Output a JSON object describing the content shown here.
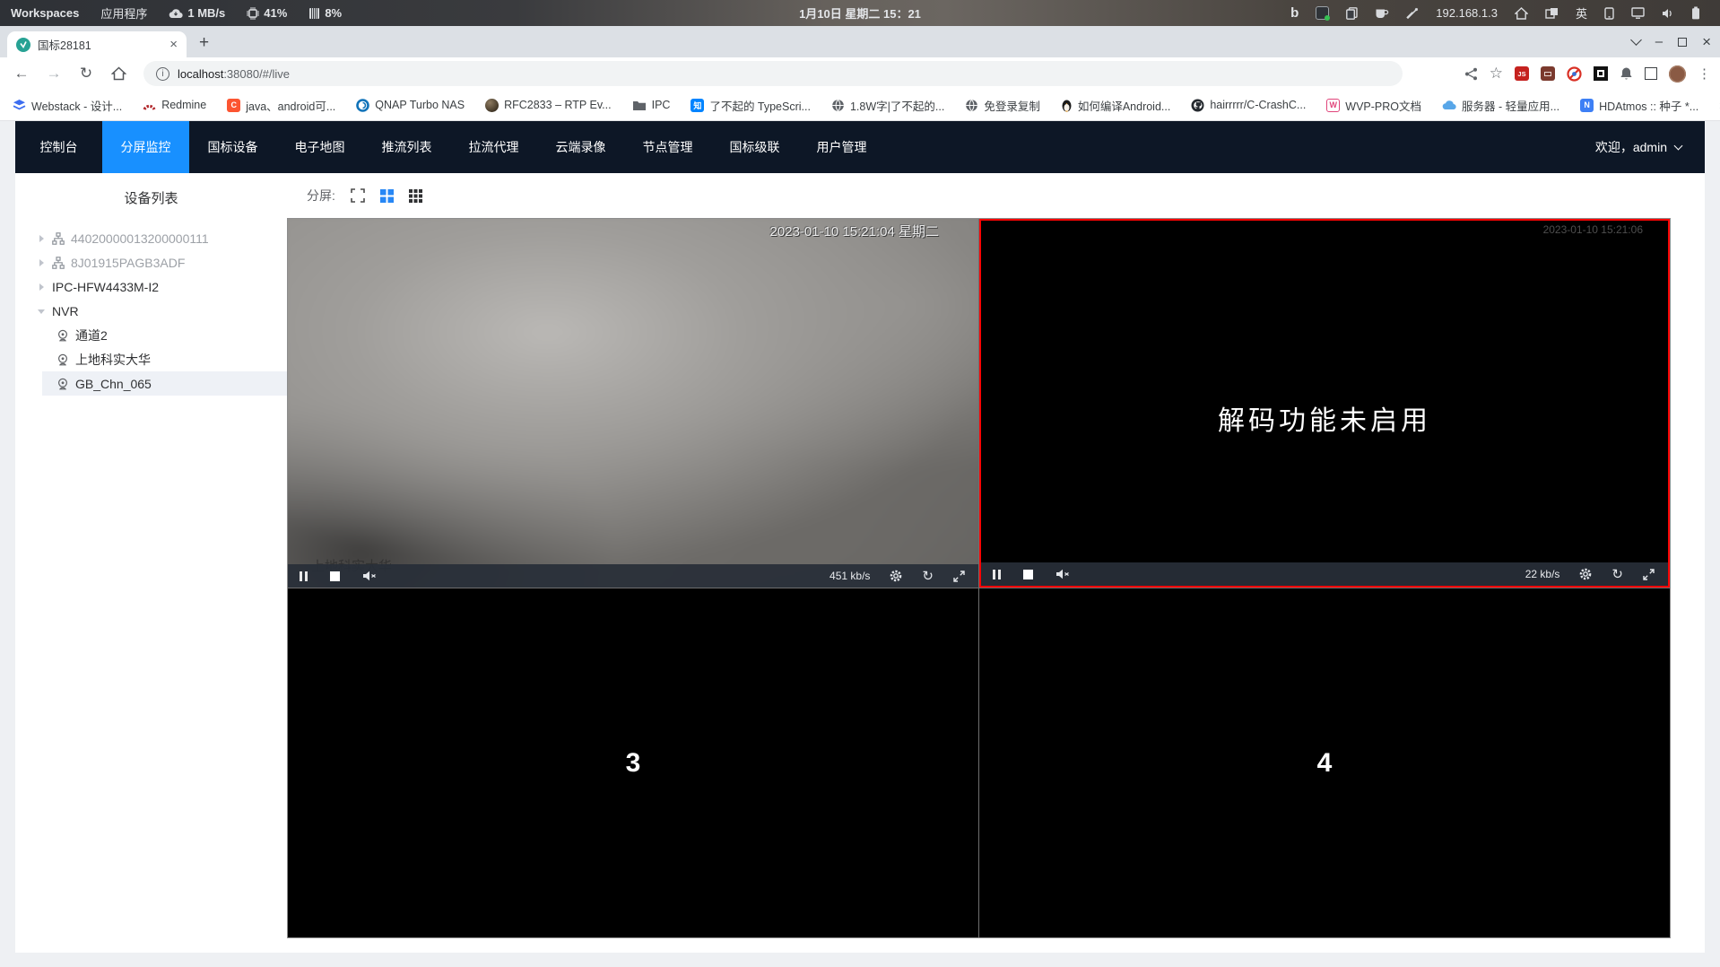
{
  "colors": {
    "accent": "#1890ff",
    "navbar_bg": "#0d1726",
    "active_video_border": "#fb0404",
    "favicon_teal": "#27a294"
  },
  "desktop_bar": {
    "workspaces": "Workspaces",
    "applications": "应用程序",
    "net_speed": "1 MB/s",
    "cpu": "41%",
    "memory": "8%",
    "clock": "1月10日 星期二 15：21",
    "ip": "192.168.1.3",
    "ime": "英"
  },
  "browser": {
    "tab_title": "国标28181",
    "url_host": "localhost",
    "url_rest": ":38080/#/live",
    "overflow": "»",
    "bookmarks": [
      "Webstack - 设计...",
      "Redmine",
      "java、android可...",
      "QNAP Turbo NAS",
      "RFC2833 – RTP Ev...",
      "IPC",
      "了不起的 TypeScri...",
      "1.8W字|了不起的...",
      "免登录复制",
      "如何编译Android...",
      "hairrrrr/C-CrashC...",
      "WVP-PRO文档",
      "服务器 - 轻量应用...",
      "HDAtmos :: 种子 *..."
    ]
  },
  "glyphs": {
    "back": "←",
    "forward": "→",
    "reload": "↻",
    "star": "☆",
    "menu": "⋮",
    "plus": "+",
    "close": "×",
    "minimize": "–",
    "info": "i",
    "bing": "b",
    "js": "JS",
    "csdn": "C",
    "zhihu": "知",
    "wvp": "W",
    "hdatmos": "N",
    "refresh": "↻"
  },
  "nav": {
    "tabs": [
      "控制台",
      "分屏监控",
      "国标设备",
      "电子地图",
      "推流列表",
      "拉流代理",
      "云端录像",
      "节点管理",
      "国标级联",
      "用户管理"
    ],
    "active_tab": "分屏监控",
    "welcome": "欢迎，admin"
  },
  "sidebar": {
    "title": "设备列表",
    "items": [
      {
        "label": "44020000013200000111"
      },
      {
        "label": "8J01915PAGB3ADF"
      },
      {
        "label": "IPC-HFW4433M-I2"
      },
      {
        "label": "NVR"
      },
      {
        "label": "通道2"
      },
      {
        "label": "上地科实大华"
      },
      {
        "label": "GB_Chn_065"
      }
    ]
  },
  "main": {
    "split_label": "分屏:",
    "video1": {
      "timestamp": "2023-01-10 15:21:04 星期二",
      "watermark": "上地科实大华",
      "bitrate": "451 kb/s"
    },
    "video2": {
      "timestamp": "2023-01-10 15:21:06",
      "message": "解码功能未启用",
      "bitrate": "22 kb/s"
    },
    "video3": {
      "label": "3"
    },
    "video4": {
      "label": "4"
    }
  }
}
